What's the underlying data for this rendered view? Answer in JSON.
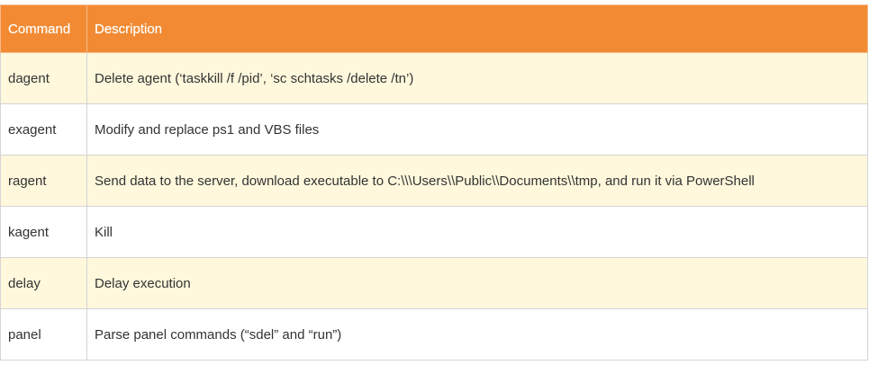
{
  "table": {
    "headers": [
      "Command",
      "Description"
    ],
    "rows": [
      [
        "dagent",
        "Delete agent (‘taskkill /f /pid’, ‘sc schtasks /delete /tn’)"
      ],
      [
        "exagent",
        "Modify and replace ps1 and VBS files"
      ],
      [
        "ragent",
        "Send data to the server, download executable to C:\\\\\\Users\\\\Public\\\\Documents\\\\tmp, and run it via PowerShell"
      ],
      [
        "kagent",
        "Kill"
      ],
      [
        "delay",
        "Delay execution"
      ],
      [
        "panel",
        "Parse panel commands (“sdel” and “run”)"
      ]
    ]
  },
  "colors": {
    "header_bg": "#f28a33",
    "header_text": "#ffffff",
    "row_alt_bg": "#fff8dc",
    "row_bg": "#ffffff",
    "border": "#d4d4d4",
    "text": "#333333"
  }
}
